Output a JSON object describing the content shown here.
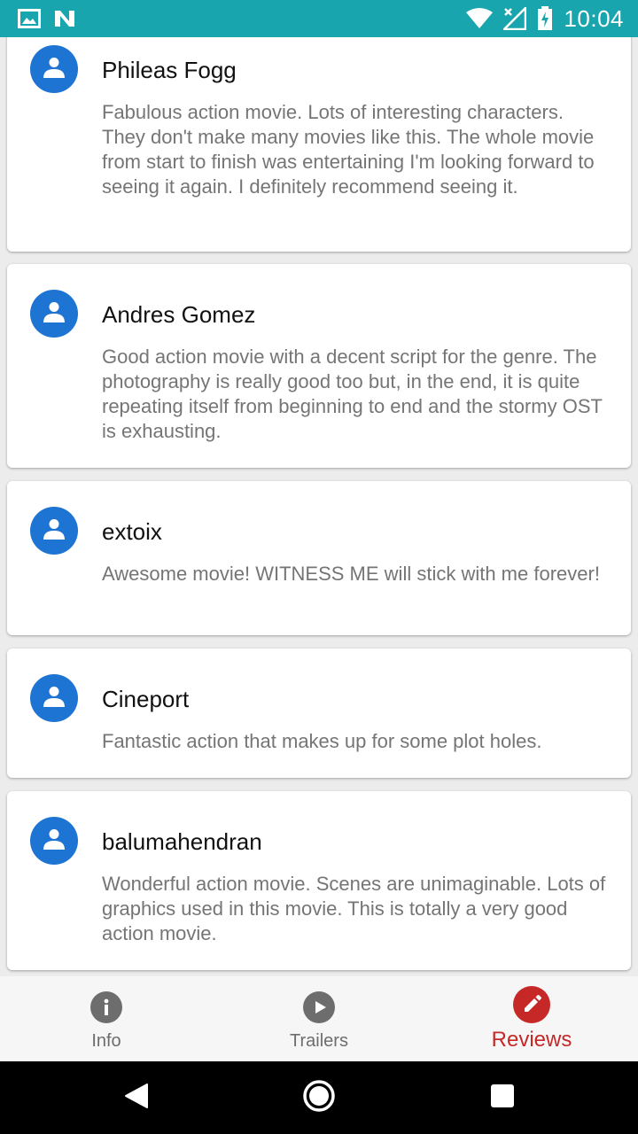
{
  "status_bar": {
    "time": "10:04",
    "icons": [
      "image-icon",
      "n-logo-icon",
      "wifi-icon",
      "signal-icon",
      "battery-charging-icon"
    ]
  },
  "reviews": [
    {
      "author": "Phileas Fogg",
      "content": "Fabulous action movie. Lots of interesting characters. They don't make many movies like this. The whole movie from start to finish was entertaining I'm looking forward to seeing it again. I definitely recommend seeing it."
    },
    {
      "author": "Andres Gomez",
      "content": "Good action movie with a decent script for the genre. The photography is really good too but, in the end, it is quite repeating itself from beginning to end and the stormy OST is exhausting."
    },
    {
      "author": "extoix",
      "content": "Awesome movie!  WITNESS ME will stick with me forever!"
    },
    {
      "author": "Cineport",
      "content": "Fantastic action that makes up for some plot holes."
    },
    {
      "author": "balumahendran",
      "content": "Wonderful action movie. Scenes are unimaginable. Lots of graphics used in this movie. This is totally a very good action movie."
    }
  ],
  "bottom_nav": {
    "items": [
      {
        "label": "Info",
        "icon": "info-icon",
        "active": false
      },
      {
        "label": "Trailers",
        "icon": "play-icon",
        "active": false
      },
      {
        "label": "Reviews",
        "icon": "pencil-icon",
        "active": true
      }
    ]
  },
  "colors": {
    "status_bar": "#19a5ad",
    "avatar": "#1e74d3",
    "active": "#c62828",
    "inactive": "#6d6d6d"
  }
}
